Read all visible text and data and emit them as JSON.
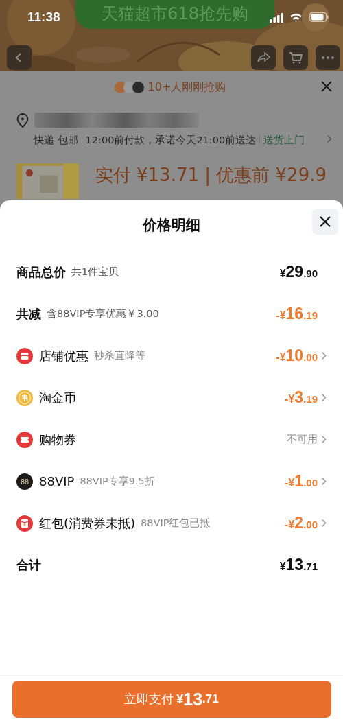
{
  "status_bar": {
    "time": "11:38"
  },
  "promo_banner": {
    "text": "天猫超市618抢先购",
    "kind": "picture"
  },
  "background_sheet": {
    "buyers_text": "10+人刚刚抢购",
    "delivery": {
      "method": "快递",
      "shipping": "包邮",
      "promise": "12:00前付款，承诺今天21:00前送达",
      "service": "送货上门"
    },
    "product": {
      "paid_label": "实付",
      "paid": "¥13.71",
      "separator": "|",
      "original_label": "优惠前",
      "original": "¥29.9"
    }
  },
  "price_sheet": {
    "title": "价格明细",
    "rows": [
      {
        "kind": "summary",
        "label": "商品总价",
        "note": "共1件宝贝",
        "amount": {
          "discount": false,
          "sign": "¥",
          "whole": "29",
          "cents": ".90"
        }
      },
      {
        "kind": "summary",
        "label": "共减",
        "note": "含88VIP专享优惠￥3.00",
        "amount": {
          "discount": true,
          "sign": "-¥",
          "whole": "16",
          "cents": ".19"
        }
      },
      {
        "kind": "store",
        "label": "店铺优惠",
        "note": "秒杀直降等",
        "amount": {
          "discount": true,
          "sign": "-¥",
          "whole": "10",
          "cents": ".00"
        }
      },
      {
        "kind": "coins",
        "label": "淘金币",
        "amount": {
          "discount": true,
          "sign": "-¥",
          "whole": "3",
          "cents": ".19"
        }
      },
      {
        "kind": "coupon",
        "label": "购物券",
        "status": "不可用"
      },
      {
        "kind": "vip",
        "icon_text": "88",
        "label": "88VIP",
        "note": "88VIP专享9.5折",
        "amount": {
          "discount": true,
          "sign": "-¥",
          "whole": "1",
          "cents": ".00"
        }
      },
      {
        "kind": "redpacket",
        "label": "红包(消费券未抵)",
        "note": "88VIP红包已抵",
        "amount": {
          "discount": true,
          "sign": "-¥",
          "whole": "2",
          "cents": ".00"
        }
      },
      {
        "kind": "summary",
        "label": "合计",
        "amount": {
          "discount": false,
          "sign": "¥",
          "whole": "13",
          "cents": ".71"
        }
      }
    ],
    "pay_button": {
      "label": "立即支付",
      "sign": "¥",
      "whole": "13",
      "cents": ".71"
    }
  }
}
